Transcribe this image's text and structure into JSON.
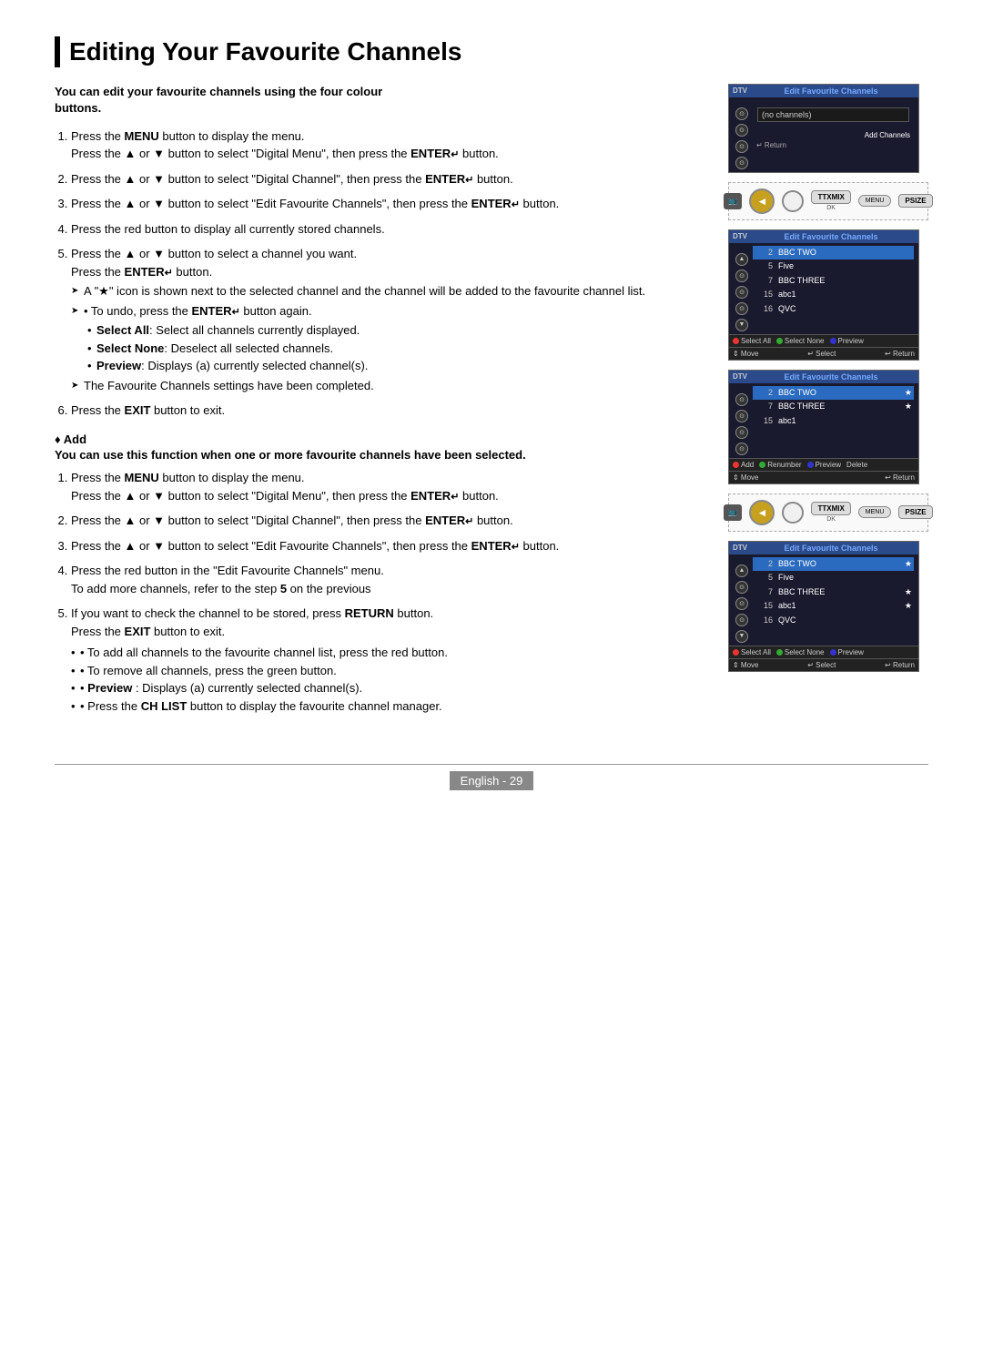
{
  "page": {
    "title": "Editing Your Favourite Channels",
    "footer": "English - 29"
  },
  "intro": {
    "text": "You can edit your favourite channels using the four colour buttons."
  },
  "section1": {
    "steps": [
      {
        "id": 1,
        "main": "Press the MENU button to display the menu.",
        "sub": "Press the ▲ or ▼ button to select \"Digital Menu\", then press the ENTER↵ button."
      },
      {
        "id": 2,
        "main": "Press the ▲ or ▼ button to select \"Digital Channel\", then press the ENTER↵ button."
      },
      {
        "id": 3,
        "main": "Press the ▲ or ▼ button to select \"Edit Favourite Channels\", then press the ENTER↵ button."
      },
      {
        "id": 4,
        "main": "Press the red button to display all currently stored channels."
      },
      {
        "id": 5,
        "main": "Press the ▲ or ▼ button to select a channel you want. Press the ENTER↵ button.",
        "arrows": [
          "A \"★\" icon is shown next to the selected channel and the channel will be added to the favourite channel list.",
          "• To undo, press the ENTER↵ button again."
        ],
        "bullets": [
          "Select All: Select all channels currently displayed.",
          "Select None: Deselect all selected channels.",
          "Preview: Displays (a) currently selected channel(s).",
          "The Favourite Channels settings have been completed."
        ],
        "last_arrow": "The Favourite Channels settings have been completed."
      },
      {
        "id": 6,
        "main": "Press the EXIT button to exit."
      }
    ]
  },
  "section_add": {
    "title": "♦ Add",
    "desc": "You can use this function when one or more favourite channels have been selected."
  },
  "section2": {
    "steps": [
      {
        "id": 1,
        "main": "Press the MENU button to display the menu.",
        "sub": "Press the ▲ or ▼ button to select \"Digital Menu\", then press the ENTER↵ button."
      },
      {
        "id": 2,
        "main": "Press the ▲ or ▼ button to select \"Digital Channel\", then press the ENTER↵ button."
      },
      {
        "id": 3,
        "main": "Press the ▲ or ▼ button to select \"Edit Favourite Channels\", then press the ENTER↵ button."
      },
      {
        "id": 4,
        "main": "Press the red button in the \"Edit Favourite Channels\" menu. To add more channels, refer to the step 5 on the previous"
      },
      {
        "id": 5,
        "main": "If you want to check the channel to be stored, press RETURN button.",
        "sub": "Press the EXIT button to exit.",
        "arrows_after": [
          "• To add all channels to the favourite channel list, press the red button.",
          "• To remove all channels, press the green button.",
          "• Preview : Displays (a) currently selected channel(s).",
          "• Press the CH LIST button to display the favourite channel manager."
        ]
      }
    ]
  },
  "screens": {
    "screen1": {
      "dtv": "DTV",
      "title": "Edit Favourite Channels",
      "no_channels": "(no channels)",
      "add_channels": "Add Channels",
      "return": "↵ Return"
    },
    "screen2": {
      "channels": [
        {
          "num": "2",
          "name": "BBC TWO",
          "star": false
        },
        {
          "num": "5",
          "name": "Five",
          "star": false
        },
        {
          "num": "7",
          "name": "BBC THREE",
          "star": false
        },
        {
          "num": "15",
          "name": "abc1",
          "star": false
        },
        {
          "num": "16",
          "name": "QVC",
          "star": false
        }
      ],
      "footer_items": [
        "Select All",
        "Select None",
        "Preview"
      ],
      "footer_bottom": [
        "Move",
        "Select",
        "Return"
      ]
    },
    "screen3": {
      "channels": [
        {
          "num": "2",
          "name": "BBC TWO",
          "star": true
        },
        {
          "num": "7",
          "name": "BBC THREE",
          "star": true
        },
        {
          "num": "15",
          "name": "abc1",
          "star": false
        }
      ],
      "footer_items": [
        "Add",
        "Renumber",
        "Preview",
        "Delete"
      ],
      "footer_bottom": [
        "Move",
        "Return"
      ]
    },
    "screen4": {
      "channels": [
        {
          "num": "2",
          "name": "BBC TWO",
          "star": true
        },
        {
          "num": "5",
          "name": "Five",
          "star": false
        },
        {
          "num": "7",
          "name": "BBC THREE",
          "star": true
        },
        {
          "num": "15",
          "name": "abc1",
          "star": true
        },
        {
          "num": "16",
          "name": "QVC",
          "star": false
        }
      ],
      "footer_items": [
        "Select All",
        "Select None",
        "Preview"
      ],
      "footer_bottom": [
        "Move",
        "Select",
        "Return"
      ]
    }
  },
  "remote": {
    "buttons": [
      "TTXMIX",
      "MENU",
      "PSIZE"
    ],
    "circles": [
      "red",
      "green",
      "yellow",
      "blue"
    ]
  }
}
